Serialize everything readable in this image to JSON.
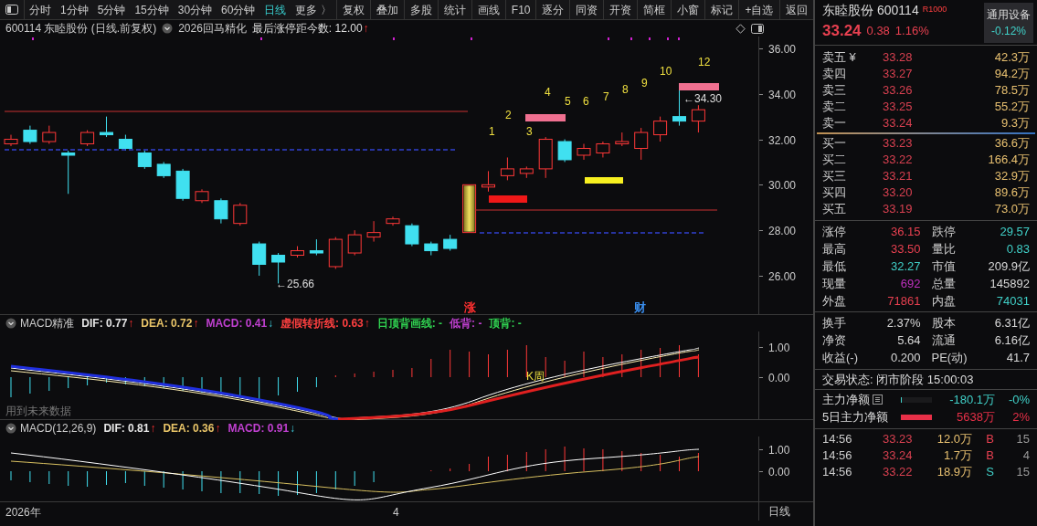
{
  "toolbar": {
    "periods": [
      {
        "label": "分时",
        "selected": false
      },
      {
        "label": "1分钟",
        "selected": false
      },
      {
        "label": "5分钟",
        "selected": false
      },
      {
        "label": "15分钟",
        "selected": false
      },
      {
        "label": "30分钟",
        "selected": false
      },
      {
        "label": "60分钟",
        "selected": false
      },
      {
        "label": "日线",
        "selected": true
      }
    ],
    "more": "更多 〉",
    "tools": [
      "复权",
      "叠加",
      "多股",
      "统计",
      "画线",
      "F10",
      "逐分",
      "同资",
      "开资",
      "简框",
      "小窗",
      "标记",
      "+自选"
    ],
    "back": "返回"
  },
  "chart": {
    "title": "600114 东睦股份 (日线.前复权)",
    "formula": "2026回马精化",
    "readout": {
      "label": "最后涨停距今数: 12.00",
      "arrow": "↑",
      "rising": true
    },
    "chart_data": {
      "type": "candlestick",
      "ohlc": [
        [
          31.8,
          32.2,
          31.7,
          32.0
        ],
        [
          32.4,
          32.6,
          31.8,
          31.9
        ],
        [
          31.9,
          32.6,
          31.8,
          32.3
        ],
        [
          31.4,
          31.5,
          29.6,
          31.3
        ],
        [
          31.8,
          32.4,
          31.7,
          32.3
        ],
        [
          32.3,
          33.0,
          32.1,
          32.2
        ],
        [
          32.0,
          32.2,
          31.5,
          31.6
        ],
        [
          31.4,
          31.5,
          30.7,
          30.8
        ],
        [
          30.9,
          31.0,
          30.3,
          30.4
        ],
        [
          30.6,
          30.7,
          29.3,
          29.4
        ],
        [
          29.3,
          29.8,
          29.2,
          29.7
        ],
        [
          29.3,
          29.4,
          28.3,
          28.5
        ],
        [
          28.3,
          29.2,
          28.2,
          29.1
        ],
        [
          27.4,
          27.5,
          26.0,
          26.5
        ],
        [
          26.9,
          27.0,
          25.66,
          26.6
        ],
        [
          26.9,
          27.3,
          26.8,
          27.1
        ],
        [
          27.1,
          27.6,
          26.9,
          27.0
        ],
        [
          26.4,
          27.7,
          26.3,
          27.6
        ],
        [
          27.0,
          28.0,
          26.9,
          27.8
        ],
        [
          27.7,
          28.4,
          27.5,
          27.9
        ],
        [
          28.3,
          28.6,
          28.2,
          28.5
        ],
        [
          28.2,
          28.3,
          27.3,
          27.4
        ],
        [
          27.4,
          27.5,
          26.9,
          27.1
        ],
        [
          27.6,
          27.8,
          27.1,
          27.2
        ],
        [
          27.9,
          30.0,
          27.9,
          30.0
        ],
        [
          29.9,
          30.6,
          29.7,
          30.0
        ],
        [
          30.4,
          31.2,
          30.2,
          30.7
        ],
        [
          30.5,
          30.8,
          30.3,
          30.7
        ],
        [
          30.7,
          32.1,
          30.3,
          32.0
        ],
        [
          31.9,
          32.0,
          31.0,
          31.1
        ],
        [
          31.3,
          31.8,
          31.1,
          31.6
        ],
        [
          31.4,
          31.9,
          31.2,
          31.8
        ],
        [
          31.8,
          32.3,
          31.7,
          31.9
        ],
        [
          31.6,
          32.5,
          31.1,
          32.3
        ],
        [
          32.2,
          33.0,
          31.9,
          32.8
        ],
        [
          33.0,
          34.3,
          32.6,
          32.8
        ],
        [
          32.8,
          33.5,
          32.3,
          33.3
        ]
      ],
      "ylim": [
        24.27,
        36.52
      ],
      "yticks": [
        {
          "value": 36,
          "label": "36.00"
        },
        {
          "value": 34,
          "label": "34.00"
        },
        {
          "value": 32,
          "label": "32.00"
        },
        {
          "value": 30,
          "label": "30.00"
        },
        {
          "value": 28,
          "label": "28.00"
        },
        {
          "value": 26,
          "label": "26.00"
        }
      ]
    },
    "wave_labels": [
      "1",
      "2",
      "3",
      "4",
      "5",
      "6",
      "7",
      "8",
      "9",
      "10",
      "12"
    ],
    "low_mark": "←25.66",
    "high_mark": "←34.30",
    "event_tags": [
      {
        "label": "涨",
        "color": "#ff3030"
      },
      {
        "label": "财",
        "color": "#3a8ff0"
      }
    ]
  },
  "indicators": [
    {
      "name": "MACD精准",
      "readouts": [
        {
          "label": "DIF: 0.77",
          "color": "#e6e6e6",
          "arrow": "↑",
          "rising": true
        },
        {
          "label": "DEA: 0.72",
          "color": "#e8c468",
          "arrow": "↑",
          "rising": true
        },
        {
          "label": "MACD: 0.41",
          "color": "#c040d0",
          "arrow": "↓",
          "rising": false
        },
        {
          "label": "虚假转折线: 0.63",
          "color": "#ff4040",
          "arrow": "↑",
          "rising": true
        },
        {
          "label": "日顶背画线: -",
          "color": "#30d050"
        },
        {
          "label": "低背: -",
          "color": "#c040d0"
        },
        {
          "label": "顶背: -",
          "color": "#30d050"
        }
      ],
      "axis": [
        "1.00",
        "0.00"
      ],
      "note": "K周",
      "footnote": "用到未来数据"
    },
    {
      "name": "MACD(12,26,9)",
      "readouts": [
        {
          "label": "DIF: 0.81",
          "color": "#e6e6e6",
          "arrow": "↑",
          "rising": true
        },
        {
          "label": "DEA: 0.36",
          "color": "#e8c468",
          "arrow": "↑",
          "rising": true
        },
        {
          "label": "MACD: 0.91",
          "color": "#c040d0",
          "arrow": "↓",
          "rising": false
        }
      ],
      "axis": [
        "1.00",
        "0.00"
      ]
    }
  ],
  "time_axis": [
    "2026年",
    "4"
  ],
  "period_label": "日线",
  "quote": {
    "name": "东睦股份",
    "code": "600114",
    "badge": "R1000",
    "sector": "通用设备",
    "sector_change": "-0.12%",
    "price": "33.24",
    "change": "0.38",
    "change_pct": "1.16%",
    "asks": [
      {
        "label": "卖五 ¥",
        "price": "33.28",
        "volume": "42.3万"
      },
      {
        "label": "卖四",
        "price": "33.27",
        "volume": "94.2万"
      },
      {
        "label": "卖三",
        "price": "33.26",
        "volume": "78.5万"
      },
      {
        "label": "卖二",
        "price": "33.25",
        "volume": "55.2万"
      },
      {
        "label": "卖一",
        "price": "33.24",
        "volume": "9.3万"
      }
    ],
    "bids": [
      {
        "label": "买一",
        "price": "33.23",
        "volume": "36.6万"
      },
      {
        "label": "买二",
        "price": "33.22",
        "volume": "166.4万"
      },
      {
        "label": "买三",
        "price": "33.21",
        "volume": "32.9万"
      },
      {
        "label": "买四",
        "price": "33.20",
        "volume": "89.6万"
      },
      {
        "label": "买五",
        "price": "33.19",
        "volume": "73.0万"
      }
    ],
    "stats": [
      [
        {
          "label": "涨停",
          "value": "36.15",
          "color": "#e84050"
        },
        {
          "label": "跌停",
          "value": "29.57",
          "color": "#40d0c8"
        }
      ],
      [
        {
          "label": "最高",
          "value": "33.50",
          "color": "#e84050"
        },
        {
          "label": "量比",
          "value": "0.83",
          "color": "#40d0c8"
        }
      ],
      [
        {
          "label": "最低",
          "value": "32.27",
          "color": "#40d0c8"
        },
        {
          "label": "市值",
          "value": "209.9亿",
          "color": "#d8d8d8"
        }
      ],
      [
        {
          "label": "现量",
          "value": "692",
          "color": "#c030c0"
        },
        {
          "label": "总量",
          "value": "145892",
          "color": "#d8d8d8"
        }
      ],
      [
        {
          "label": "外盘",
          "value": "71861",
          "color": "#e84050"
        },
        {
          "label": "内盘",
          "value": "74031",
          "color": "#40d0c8"
        }
      ]
    ],
    "fundamentals": [
      [
        {
          "label": "换手",
          "value": "2.37%"
        },
        {
          "label": "股本",
          "value": "6.31亿"
        }
      ],
      [
        {
          "label": "净资",
          "value": "5.64"
        },
        {
          "label": "流通",
          "value": "6.16亿"
        }
      ],
      [
        {
          "label": "收益(-)",
          "value": "0.200"
        },
        {
          "label": "PE(动)",
          "value": "41.7"
        }
      ]
    ],
    "trade_status": "交易状态: 闭市阶段 15:00:03",
    "flows": [
      {
        "label": "主力净额",
        "value": "-180.1万",
        "pct": "-0%",
        "color": "#40d0c8",
        "level": 0.04
      },
      {
        "label": "5日主力净额",
        "value": "5638万",
        "pct": "2%",
        "color": "#e83048",
        "level": 1
      }
    ],
    "ticks": [
      {
        "time": "14:56",
        "price": "33.23",
        "volume": "12.0万",
        "side": "B",
        "color": "#e84050",
        "count": "15"
      },
      {
        "time": "14:56",
        "price": "33.24",
        "volume": "1.7万",
        "side": "B",
        "color": "#e84050",
        "count": "4"
      },
      {
        "time": "14:56",
        "price": "33.22",
        "volume": "18.9万",
        "side": "S",
        "color": "#40d0c8",
        "count": "15"
      }
    ]
  }
}
